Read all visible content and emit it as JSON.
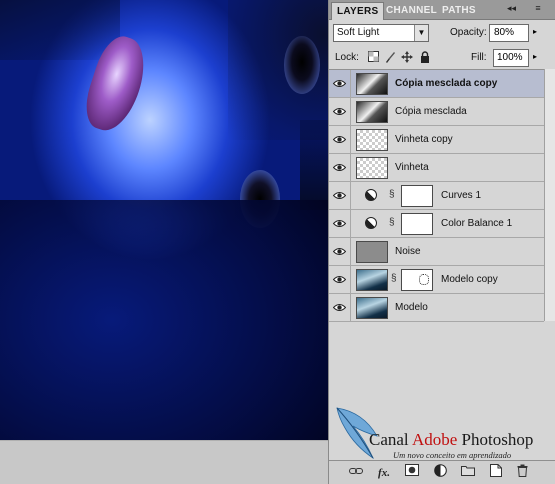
{
  "tabs": [
    {
      "label": "LAYERS",
      "active": true
    },
    {
      "label": "CHANNEL",
      "active": false
    },
    {
      "label": "PATHS",
      "active": false
    }
  ],
  "panel_controls": {
    "collapse": "◂◂",
    "menu": "≡"
  },
  "blend_mode": "Soft Light",
  "opacity_label": "Opacity:",
  "opacity_value": "80%",
  "lock_label": "Lock:",
  "fill_label": "Fill:",
  "fill_value": "100%",
  "layers": [
    {
      "name": "Cópia mesclada copy",
      "thumb": "copia",
      "selected": true,
      "bold": true
    },
    {
      "name": "Cópia mesclada",
      "thumb": "copia"
    },
    {
      "name": "Vinheta copy",
      "thumb": "vinheta"
    },
    {
      "name": "Vinheta",
      "thumb": "vinheta"
    },
    {
      "name": "Curves 1",
      "adjustment": "curves-adjustment-icon"
    },
    {
      "name": "Color Balance 1",
      "adjustment": "color-balance-adjustment-icon"
    },
    {
      "name": "Noise",
      "thumb": "gray"
    },
    {
      "name": "Modelo copy",
      "thumb": "photo",
      "mask": true
    },
    {
      "name": "Modelo",
      "thumb": "photo"
    }
  ],
  "logo": {
    "canal": "Canal ",
    "adobe": "Adobe",
    "photoshop": " Photoshop",
    "subtitle": "Um novo conceito em aprendizado"
  },
  "footer_icons": [
    "link-layers-icon",
    "fx-icon",
    "add-mask-icon",
    "adjustment-layer-icon",
    "new-group-icon",
    "new-layer-icon",
    "trash-icon"
  ]
}
